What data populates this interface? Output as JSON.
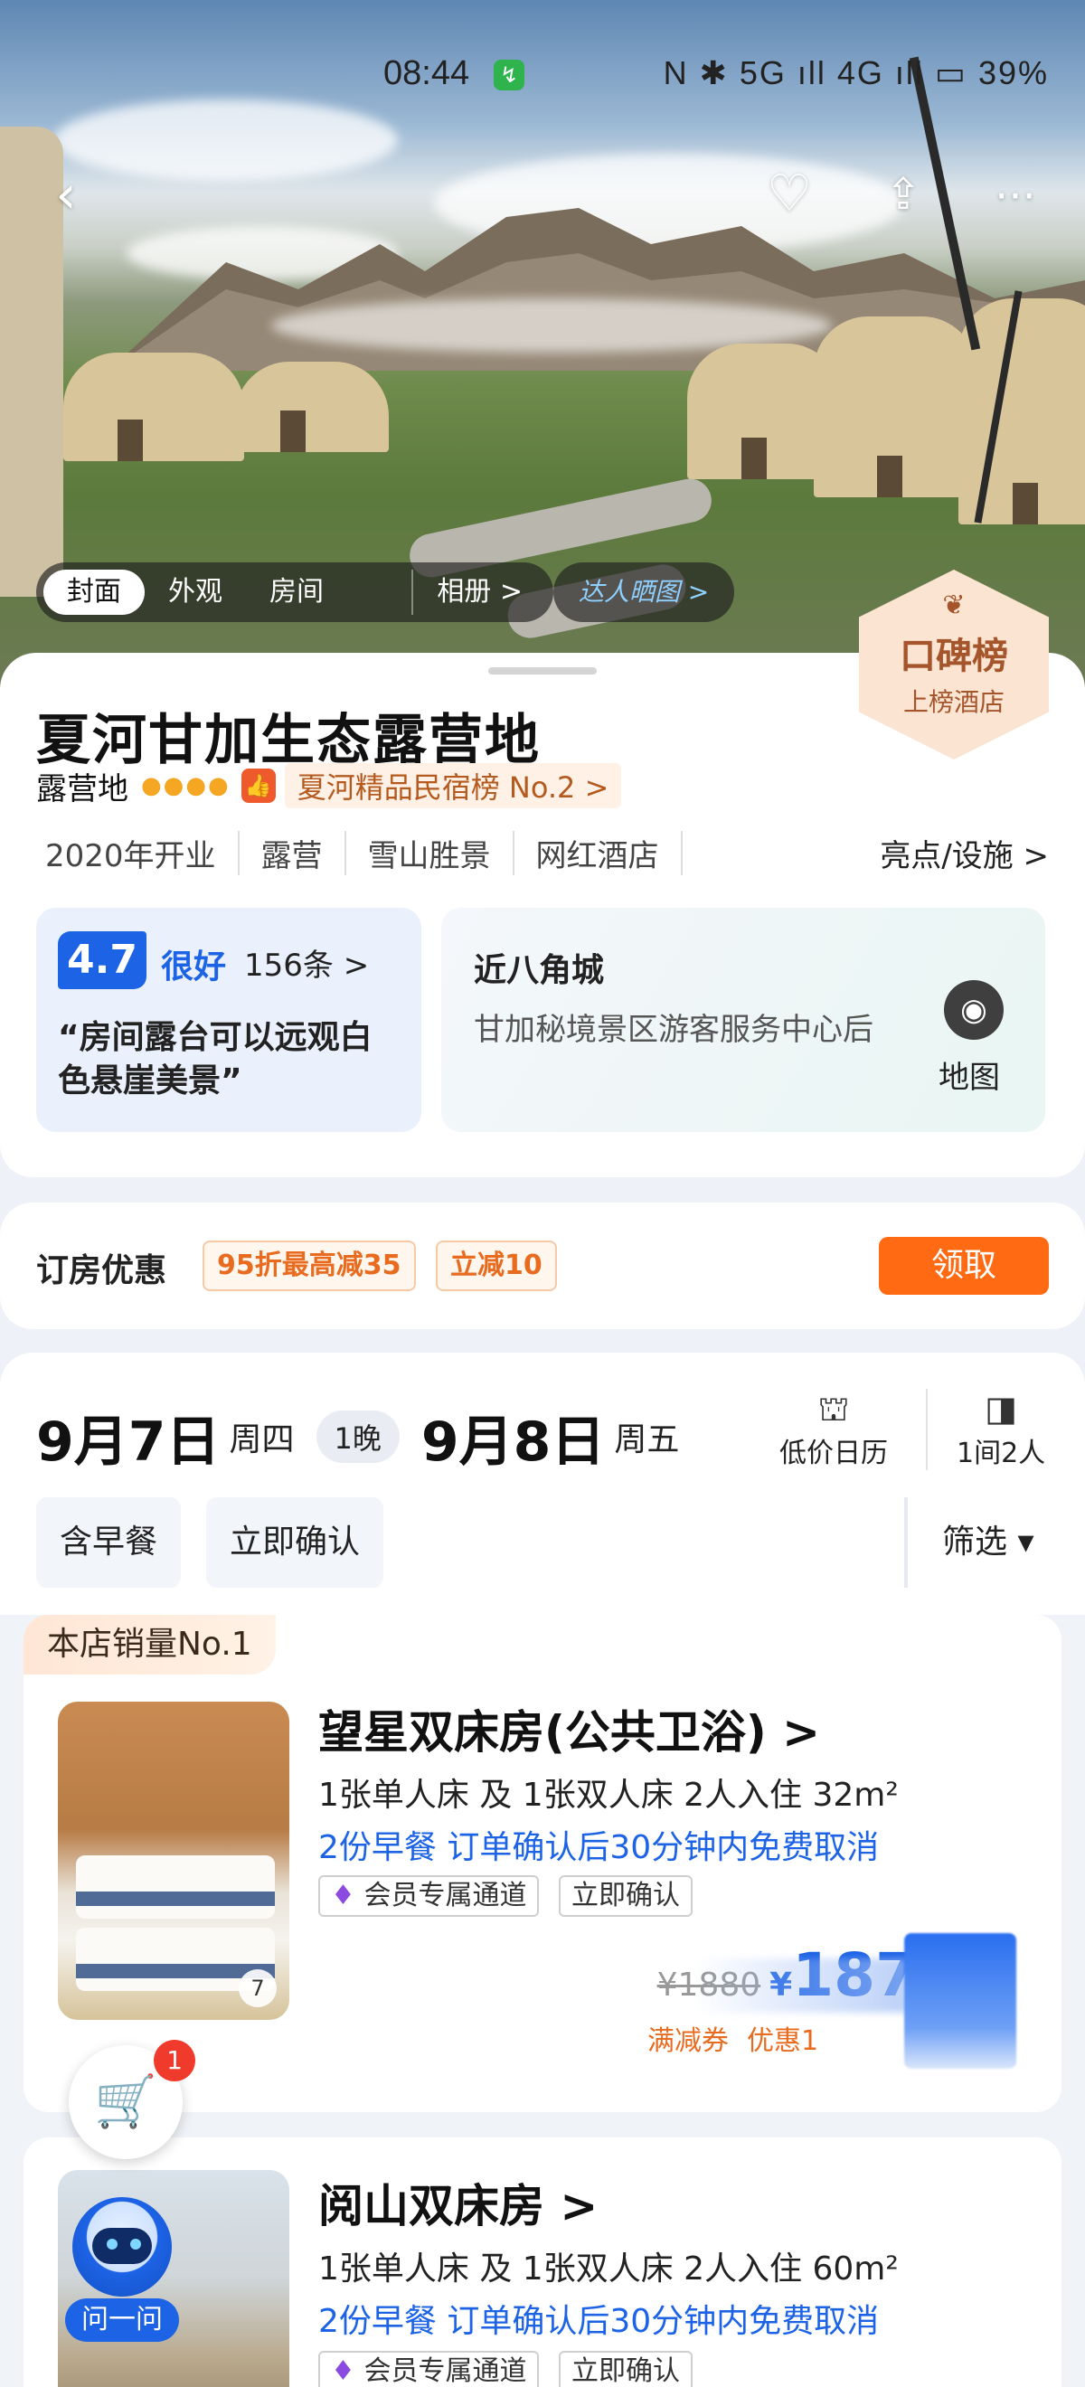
{
  "status_bar": {
    "time": "08:44",
    "icons": "N ✱ 5G ıll 4G ıll",
    "battery": "39%"
  },
  "header": {
    "back_icon": "back-chevron-icon",
    "favorite_icon": "heart-plus-icon",
    "share_icon": "share-icon",
    "more_icon": "more-dots-icon"
  },
  "gallery": {
    "tabs": [
      "封面",
      "外观",
      "房间"
    ],
    "album": "相册 >",
    "expert_photos": "达人晒图 >"
  },
  "koubei": {
    "title": "口碑榜",
    "subtitle": "上榜酒店"
  },
  "hotel": {
    "name": "夏河甘加生态露营地",
    "type": "露营地",
    "rank": "夏河精品民宿榜 No.2 >",
    "tags": [
      "2020年开业",
      "露营",
      "雪山胜景",
      "网红酒店"
    ],
    "facilities": "亮点/设施 >"
  },
  "review": {
    "score": "4.7",
    "word": "很好",
    "count": "156条 >",
    "quote": "“房间露台可以远观白色悬崖美景”"
  },
  "location": {
    "title": "近八角城",
    "address": "甘加秘境景区游客服务中心后",
    "map_label": "地图"
  },
  "offers": {
    "title": "订房优惠",
    "coupon1": "95折最高减35",
    "coupon2": "立减10",
    "claim": "领取"
  },
  "dates": {
    "checkin": "9月7日",
    "checkin_week": "周四",
    "nights": "1晚",
    "checkout": "9月8日",
    "checkout_week": "周五",
    "calendar_label": "低价日历",
    "guests_label": "1间2人"
  },
  "filters": {
    "breakfast": "含早餐",
    "instant": "立即确认",
    "filter": "筛选 ▾"
  },
  "rooms": [
    {
      "badge": "本店销量No.1",
      "title": "望星双床房(公共卫浴) >",
      "beds": "1张单人床 及 1张双人床  2人入住  32m²",
      "policy": "2份早餐  订单确认后30分钟内免费取消",
      "perk1": "会员专属通道",
      "perk2": "立即确认",
      "image_count": "7",
      "old_price": "¥1880",
      "currency": "¥",
      "price": "187",
      "discount1": "满减券",
      "discount2": "优惠1"
    },
    {
      "title": "阅山双床房 >",
      "beds": "1张单人床 及 1张双人床  2人入住  60m²",
      "policy": "2份早餐  订单确认后30分钟内免费取消",
      "perk1": "会员专属通道",
      "perk2": "立即确认"
    }
  ],
  "cart": {
    "count": "1"
  },
  "assistant": {
    "label": "问一问"
  }
}
